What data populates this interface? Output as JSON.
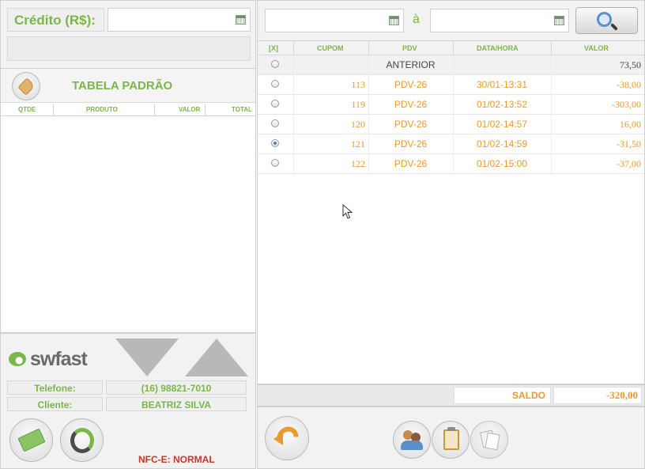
{
  "credit": {
    "label": "Crédito (R$):",
    "value": ""
  },
  "left_panel": {
    "table_name": "TABELA PADRÃO",
    "columns": [
      "QTDE",
      "PRODUTO",
      "VALOR",
      "TOTAL"
    ],
    "logo_text": "swfast",
    "phone_label": "Telefone:",
    "phone_value": "(16) 98821-7010",
    "client_label": "Cliente:",
    "client_value": "BEATRIZ SILVA",
    "nfce_status": "NFC-E: NORMAL"
  },
  "filter": {
    "date_from": "",
    "separator": "à",
    "date_to": ""
  },
  "table": {
    "columns": [
      "[X]",
      "CUPOM",
      "PDV",
      "DATA/HORA",
      "VALOR"
    ],
    "rows": [
      {
        "cupom": "",
        "pdv": "ANTERIOR",
        "datahora": "",
        "valor": "73,50",
        "selected": false
      },
      {
        "cupom": "113",
        "pdv": "PDV-26",
        "datahora": "30/01-13:31",
        "valor": "-38,00",
        "selected": false
      },
      {
        "cupom": "119",
        "pdv": "PDV-26",
        "datahora": "01/02-13:52",
        "valor": "-303,00",
        "selected": false
      },
      {
        "cupom": "120",
        "pdv": "PDV-26",
        "datahora": "01/02-14:57",
        "valor": "16,00",
        "selected": false
      },
      {
        "cupom": "121",
        "pdv": "PDV-26",
        "datahora": "01/02-14:59",
        "valor": "-31,50",
        "selected": true
      },
      {
        "cupom": "122",
        "pdv": "PDV-26",
        "datahora": "01/02-15:00",
        "valor": "-37,00",
        "selected": false
      }
    ]
  },
  "saldo": {
    "label": "SALDO",
    "value": "-320,00"
  },
  "colors": {
    "green": "#7ab648",
    "orange": "#e89a2c",
    "panel": "#f2f2f2"
  }
}
